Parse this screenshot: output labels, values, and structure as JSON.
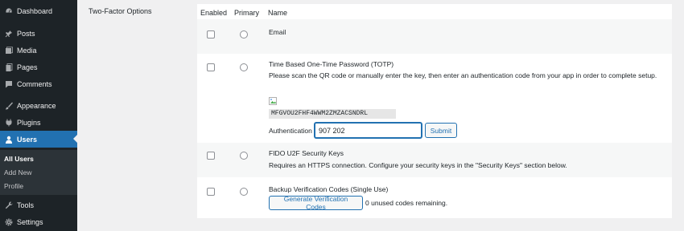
{
  "sidebar": {
    "items": [
      {
        "label": "Dashboard",
        "icon": "dashboard-icon"
      },
      {
        "label": "Posts",
        "icon": "pin-icon"
      },
      {
        "label": "Media",
        "icon": "media-icon"
      },
      {
        "label": "Pages",
        "icon": "pages-icon"
      },
      {
        "label": "Comments",
        "icon": "comments-icon"
      },
      {
        "label": "Appearance",
        "icon": "brush-icon"
      },
      {
        "label": "Plugins",
        "icon": "plugins-icon"
      },
      {
        "label": "Users",
        "icon": "user-icon"
      },
      {
        "label": "Tools",
        "icon": "wrench-icon"
      },
      {
        "label": "Settings",
        "icon": "settings-icon"
      }
    ],
    "submenu": [
      "All Users",
      "Add New",
      "Profile"
    ]
  },
  "section_label": "Two-Factor Options",
  "table": {
    "headers": [
      "Enabled",
      "Primary",
      "Name"
    ],
    "rows": [
      {
        "title": "Email"
      },
      {
        "title": "Time Based One-Time Password (TOTP)",
        "description": "Please scan the QR code or manually enter the key, then enter an authentication code from your app in order to complete setup.",
        "secret_key": "MFGVOU2FHF4WWM2ZMZACSNDRL",
        "auth_label": "Authentication Code:",
        "auth_value": "907 202",
        "submit_label": "Submit"
      },
      {
        "title": "FIDO U2F Security Keys",
        "description": "Requires an HTTPS connection. Configure your security keys in the \"Security Keys\" section below."
      },
      {
        "title": "Backup Verification Codes (Single Use)",
        "button_label": "Generate Verification Codes",
        "note": "0 unused codes remaining."
      }
    ]
  },
  "colors": {
    "accent": "#2271b1",
    "sidebar_bg": "#1d2327"
  }
}
